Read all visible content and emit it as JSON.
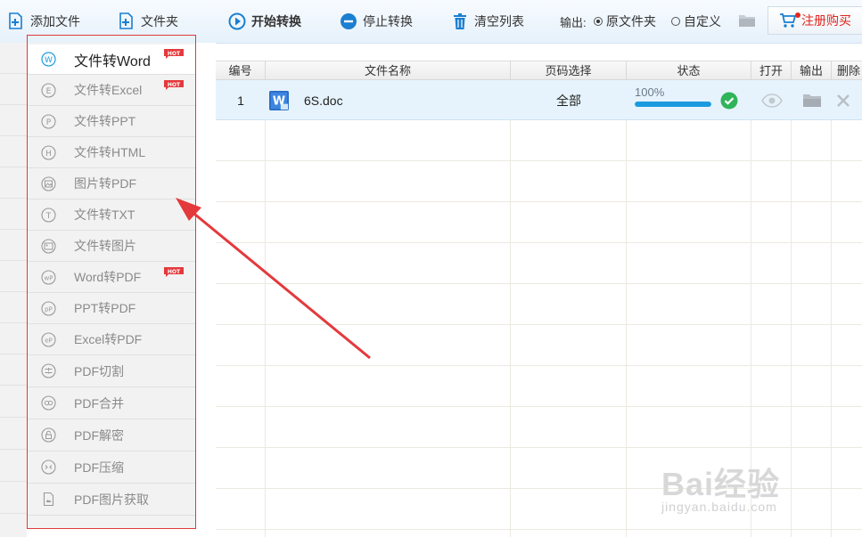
{
  "toolbar": {
    "add_file": "添加文件",
    "add_folder": "文件夹",
    "start": "开始转换",
    "stop": "停止转换",
    "clear": "清空列表",
    "output_label": "输出:",
    "output_options": [
      {
        "label": "原文件夹",
        "selected": true
      },
      {
        "label": "自定义",
        "selected": false
      }
    ],
    "buy": "注册购买"
  },
  "sidebar": {
    "items": [
      {
        "label": "文件转Word",
        "icon": "W",
        "hot": true,
        "active": true
      },
      {
        "label": "文件转Excel",
        "icon": "E",
        "hot": true
      },
      {
        "label": "文件转PPT",
        "icon": "P"
      },
      {
        "label": "文件转HTML",
        "icon": "H"
      },
      {
        "label": "图片转PDF",
        "icon": "image"
      },
      {
        "label": "文件转TXT",
        "icon": "T"
      },
      {
        "label": "文件转图片",
        "icon": "image2"
      },
      {
        "label": "Word转PDF",
        "icon": "wP",
        "hot": true
      },
      {
        "label": "PPT转PDF",
        "icon": "pP"
      },
      {
        "label": "Excel转PDF",
        "icon": "eP"
      },
      {
        "label": "PDF切割",
        "icon": "cut"
      },
      {
        "label": "PDF合并",
        "icon": "merge"
      },
      {
        "label": "PDF解密",
        "icon": "unlock"
      },
      {
        "label": "PDF压缩",
        "icon": "compress"
      },
      {
        "label": "PDF图片获取",
        "icon": "pdfimage"
      }
    ],
    "hot_badge": "HOT"
  },
  "table": {
    "columns": [
      "编号",
      "文件名称",
      "页码选择",
      "状态",
      "打开",
      "输出",
      "删除"
    ],
    "rows": [
      {
        "index": "1",
        "filename": "6S.doc",
        "pages": "全部",
        "progress": "100%",
        "progress_value": 100,
        "done": true
      }
    ]
  },
  "watermark": {
    "logo": "Bai经验",
    "url": "jingyan.baidu.com"
  },
  "colors": {
    "accent": "#1a9be0",
    "annotation": "#e4393c",
    "success": "#2fb45a",
    "buy": "#e4251f"
  }
}
